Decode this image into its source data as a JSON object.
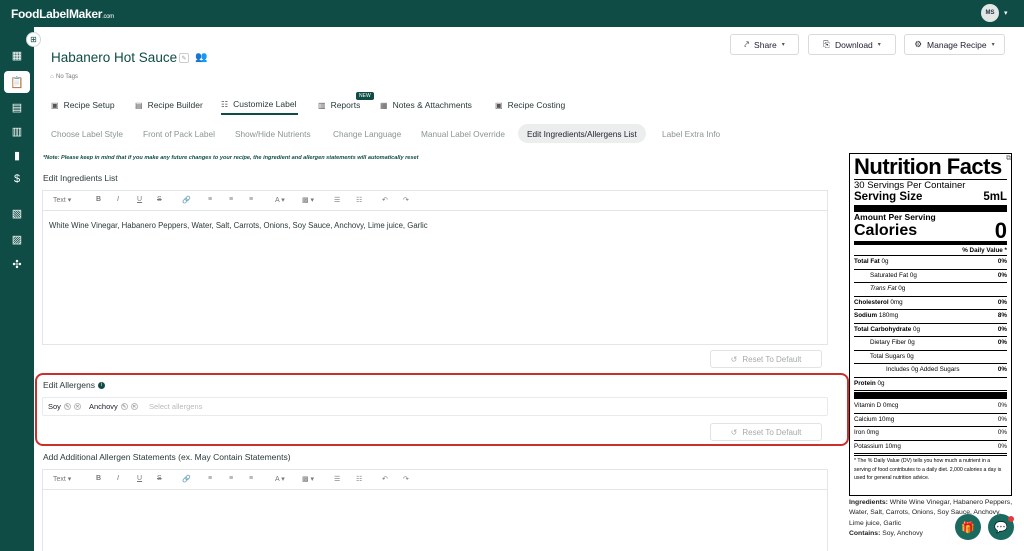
{
  "app": {
    "logo": "FoodLabelMaker",
    "logo_suffix": ".com",
    "user_initials": "MS"
  },
  "recipe": {
    "title": "Habanero Hot Sauce",
    "tags": "No Tags"
  },
  "header_actions": {
    "share": "Share",
    "download": "Download",
    "manage": "Manage Recipe"
  },
  "tabs": [
    {
      "label": "Recipe Setup"
    },
    {
      "label": "Recipe Builder"
    },
    {
      "label": "Customize Label"
    },
    {
      "label": "Reports",
      "badge": "NEW"
    },
    {
      "label": "Notes & Attachments"
    },
    {
      "label": "Recipe Costing"
    }
  ],
  "subtabs": [
    "Choose Label Style",
    "Front of Pack Label",
    "Show/Hide Nutrients",
    "Change Language",
    "Manual Label Override",
    "Edit Ingredients/Allergens List",
    "Label Extra Info"
  ],
  "note": "*Note: Please keep in mind that if you make any future changes to your recipe, the ingredient and allergen statements will automatically reset",
  "ingredients_section": {
    "label": "Edit Ingredients List",
    "toolbar_text": "Text",
    "content": "White Wine Vinegar, Habanero Peppers, Water, Salt, Carrots, Onions, Soy Sauce, Anchovy, Lime juice, Garlic",
    "reset": "Reset To Default"
  },
  "allergens_section": {
    "label": "Edit Allergens",
    "chips": [
      "Soy",
      "Anchovy"
    ],
    "placeholder": "Select allergens",
    "reset": "Reset To Default"
  },
  "additional_section": {
    "label": "Add Additional Allergen Statements (ex. May Contain Statements)",
    "toolbar_text": "Text"
  },
  "nutrition": {
    "title": "Nutrition Facts",
    "servings": "30 Servings Per Container",
    "serving_size_label": "Serving Size",
    "serving_size": "5mL",
    "amount_per_serving": "Amount Per Serving",
    "calories_label": "Calories",
    "calories": "0",
    "dv_header": "% Daily Value *",
    "rows": [
      {
        "label": "Total Fat",
        "amount": "0g",
        "dv": "0%",
        "bold": true,
        "indent": 0
      },
      {
        "label": "Saturated Fat",
        "amount": "0g",
        "dv": "0%",
        "bold": false,
        "indent": 1
      },
      {
        "label": "Trans Fat",
        "amount": "0g",
        "dv": "",
        "bold": false,
        "indent": 1,
        "italic": "Trans"
      },
      {
        "label": "Cholesterol",
        "amount": "0mg",
        "dv": "0%",
        "bold": true,
        "indent": 0
      },
      {
        "label": "Sodium",
        "amount": "180mg",
        "dv": "8%",
        "bold": true,
        "indent": 0
      },
      {
        "label": "Total Carbohydrate",
        "amount": "0g",
        "dv": "0%",
        "bold": true,
        "indent": 0
      },
      {
        "label": "Dietary Fiber",
        "amount": "0g",
        "dv": "0%",
        "bold": false,
        "indent": 1
      },
      {
        "label": "Total Sugars",
        "amount": "0g",
        "dv": "",
        "bold": false,
        "indent": 1
      },
      {
        "label": "Includes 0g Added Sugars",
        "amount": "",
        "dv": "0%",
        "bold": false,
        "indent": 2
      },
      {
        "label": "Protein",
        "amount": "0g",
        "dv": "",
        "bold": true,
        "indent": 0
      }
    ],
    "vitamins": [
      {
        "label": "Vitamin D",
        "amount": "0mcg",
        "dv": "0%"
      },
      {
        "label": "Calcium",
        "amount": "10mg",
        "dv": "0%"
      },
      {
        "label": "Iron",
        "amount": "0mg",
        "dv": "0%"
      },
      {
        "label": "Potassium",
        "amount": "10mg",
        "dv": "0%"
      }
    ],
    "footnote": "* The % Daily Value (DV) tells you how much a nutrient in a serving of food contributes to a daily diet. 2,000 calories a day is used for general nutrition advice."
  },
  "label_ingredients": {
    "ingredients_label": "Ingredients:",
    "ingredients": "White Wine Vinegar, Habanero Peppers, Water, Salt, Carrots, Onions, Soy Sauce, Anchovy, Lime juice, Garlic",
    "contains_label": "Contains:",
    "contains": "Soy, Anchovy"
  },
  "colors": {
    "brand": "#0f4c45",
    "highlight": "#c9302c"
  }
}
